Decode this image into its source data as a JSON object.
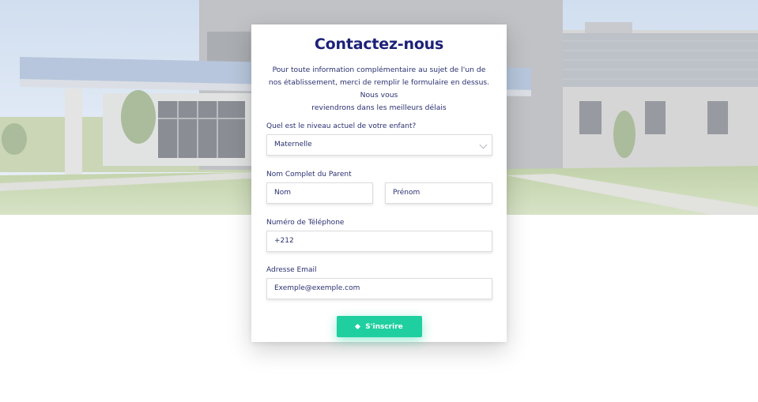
{
  "form": {
    "title": "Contactez-nous",
    "description_lines": [
      "Pour toute information complémentaire au sujet de l'un de",
      "nos établissement, merci de remplir le formulaire en dessus. Nous vous",
      "reviendrons dans les meilleurs délais"
    ],
    "level": {
      "label": "Quel est le niveau actuel de votre enfant?",
      "value": "Maternelle"
    },
    "parent_name": {
      "label": "Nom Complet du Parent",
      "last_name_placeholder": "Nom",
      "first_name_placeholder": "Prénom"
    },
    "phone": {
      "label": "Numéro de Téléphone",
      "value": "+212"
    },
    "email": {
      "label": "Adresse Email",
      "placeholder": "Exemple@exemple.com"
    },
    "submit_label": "S'inscrire"
  },
  "colors": {
    "title": "#1c2178",
    "text": "#2a3170",
    "accent": "#1fcf9f"
  },
  "icons": {
    "select_arrow": "chevron-down-icon",
    "submit": "diamond-icon"
  }
}
